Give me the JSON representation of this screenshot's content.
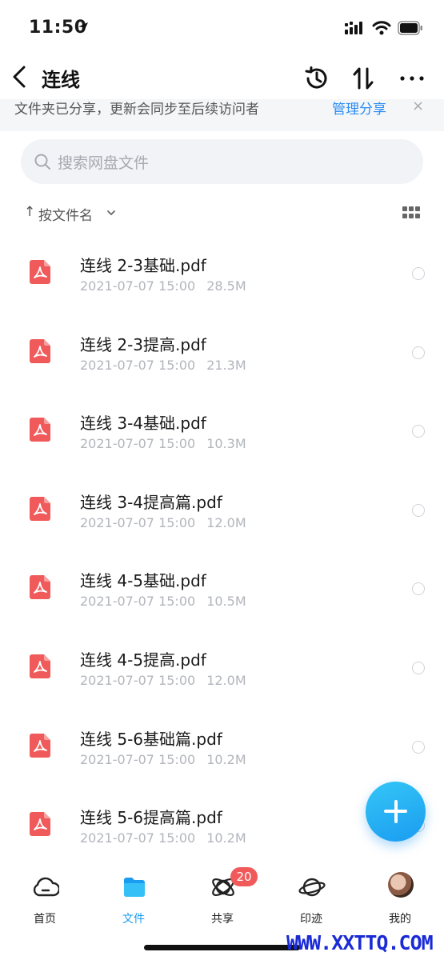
{
  "status_bar": {
    "time": "11:50"
  },
  "header": {
    "title": "连线"
  },
  "banner": {
    "text": "文件夹已分享，更新会同步至后续访问者",
    "link": "管理分享",
    "close": "×"
  },
  "search": {
    "placeholder": "搜索网盘文件"
  },
  "sort": {
    "arrow": "↑",
    "label": "按文件名"
  },
  "files": [
    {
      "name": "连线 2-3基础.pdf",
      "date": "2021-07-07 15:00",
      "size": "28.5M"
    },
    {
      "name": "连线 2-3提高.pdf",
      "date": "2021-07-07 15:00",
      "size": "21.3M"
    },
    {
      "name": "连线 3-4基础.pdf",
      "date": "2021-07-07 15:00",
      "size": "10.3M"
    },
    {
      "name": "连线 3-4提高篇.pdf",
      "date": "2021-07-07 15:00",
      "size": "12.0M"
    },
    {
      "name": "连线 4-5基础.pdf",
      "date": "2021-07-07 15:00",
      "size": "10.5M"
    },
    {
      "name": "连线 4-5提高.pdf",
      "date": "2021-07-07 15:00",
      "size": "12.0M"
    },
    {
      "name": "连线 5-6基础篇.pdf",
      "date": "2021-07-07 15:00",
      "size": "10.2M"
    },
    {
      "name": "连线 5-6提高篇.pdf",
      "date": "2021-07-07 15:00",
      "size": "10.2M"
    }
  ],
  "nav": {
    "home": "首页",
    "files": "文件",
    "shared": "共享",
    "shared_badge": "20",
    "traces": "印迹",
    "me": "我的"
  },
  "watermark": "WWW.XXTTQ.COM",
  "colors": {
    "accent": "#1a9cf0",
    "pdf_red": "#f05a5a",
    "badge": "#f05a5a"
  }
}
